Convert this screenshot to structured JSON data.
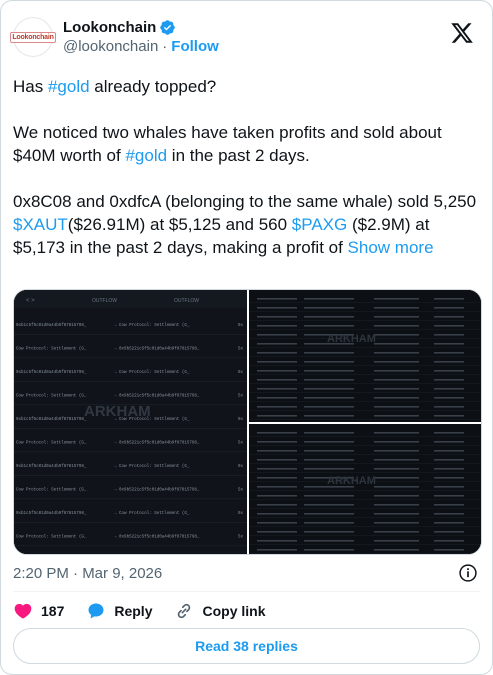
{
  "author": {
    "display_name": "Lookonchain",
    "handle": "@lookonchain",
    "follow_label": "Follow",
    "avatar_text": "Lookonchain"
  },
  "post": {
    "line1_pre": "Has ",
    "line1_tag": "#gold",
    "line1_post": " already topped?",
    "p2_pre": "We noticed two whales have taken profits and sold about $40M worth of ",
    "p2_tag": "#gold",
    "p2_post": " in the past 2 days.",
    "p3_a": "0x8C08 and 0xdfcA (belonging to the same whale) sold 5,250 ",
    "p3_xaut": "$XAUT",
    "p3_b": "($26.91M) at $5,125 and 560 ",
    "p3_paxg": "$PAXG",
    "p3_c": " ($2.9M) at $5,173 in the past 2 days, making a profit of ",
    "show_more": "Show more"
  },
  "media": {
    "watermark": "ARKHAM",
    "left_headers": [
      "OUTFLOW",
      "OUTFLOW"
    ],
    "left_rows": [
      [
        "0xb1c5f5c01d0a44b9f87815798_",
        "Cow Protocol: Settlement (G_",
        "0x"
      ],
      [
        "Cow Protocol: Settlement (G_",
        "0x9b5221c5f5c01d0a44b9f87815798_",
        "5x"
      ],
      [
        "0xb1c5f5c01d0a44b9f87815798_",
        "Cow Protocol: Settlement (G_",
        "0x"
      ],
      [
        "Cow Protocol: Settlement (G_",
        "0x9b5221c5f5c01d0a44b9f87815798_",
        "5x"
      ],
      [
        "0xb1c5f5c01d0a44b9f87815798_",
        "Cow Protocol: Settlement (G_",
        "0x"
      ],
      [
        "Cow Protocol: Settlement (G_",
        "0x9b5221c5f5c01d0a44b9f87815798_",
        "5x"
      ],
      [
        "0xb1c5f5c01d0a44b9f87815798_",
        "Cow Protocol: Settlement (G_",
        "0x"
      ],
      [
        "Cow Protocol: Settlement (G_",
        "0x9b5221c5f5c01d0a44b9f87815798_",
        "5x"
      ],
      [
        "0xb1c5f5c01d0a44b9f87815798_",
        "Cow Protocol: Settlement (G_",
        "0x"
      ],
      [
        "Cow Protocol: Settlement (G_",
        "0x9b5221c5f5c01d0a44b9f87815798_",
        "5x"
      ]
    ]
  },
  "meta": {
    "timestamp": "2:20 PM · Mar 9, 2026"
  },
  "actions": {
    "likes": "187",
    "reply_label": "Reply",
    "copy_link_label": "Copy link",
    "read_replies_label": "Read 38 replies"
  },
  "colors": {
    "accent": "#1d9bf0",
    "like": "#f91880",
    "text": "#0f1419",
    "muted": "#536471",
    "verified": "#1d9bf0"
  }
}
